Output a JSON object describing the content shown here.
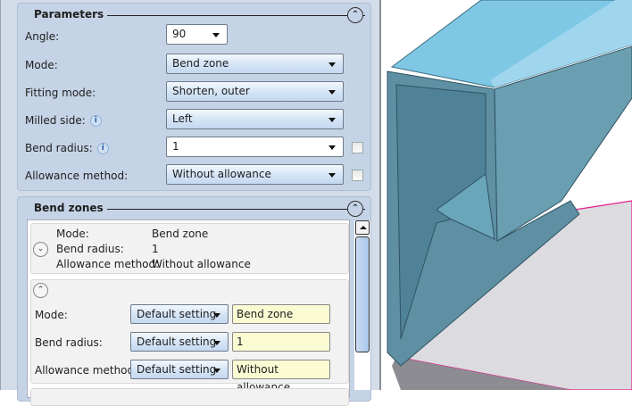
{
  "parameters": {
    "title": "Parameters",
    "angle": {
      "label": "Angle:",
      "value": "90"
    },
    "mode": {
      "label": "Mode:",
      "value": "Bend zone"
    },
    "fitting_mode": {
      "label": "Fitting mode:",
      "value": "Shorten, outer"
    },
    "milled_side": {
      "label": "Milled side:",
      "value": "Left"
    },
    "bend_radius": {
      "label": "Bend radius:",
      "value": "1"
    },
    "allowance_method": {
      "label": "Allowance method:",
      "value": "Without allowance"
    },
    "info_glyph": "i"
  },
  "bend_zones": {
    "title": "Bend zones",
    "summary": {
      "mode_label": "Mode:",
      "mode_value": "Bend zone",
      "radius_label": "Bend radius:",
      "radius_value": "1",
      "allowance_label": "Allowance method:",
      "allowance_value": "Without allowance"
    },
    "detail": {
      "mode_label": "Mode:",
      "mode_setting": "Default setting",
      "mode_value": "Bend zone",
      "radius_label": "Bend radius:",
      "radius_setting": "Default setting",
      "radius_value": "1",
      "allowance_label": "Allowance method:",
      "allowance_setting": "Default setting",
      "allowance_value": "Without allowance"
    }
  },
  "colors": {
    "steel": "#5f95a8",
    "highlight": "#e0218a",
    "panel": "#c5d3e6"
  }
}
